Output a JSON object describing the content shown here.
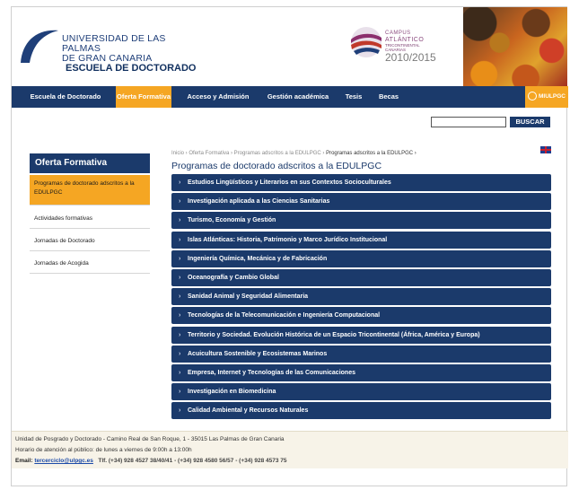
{
  "header": {
    "university_line1": "UNIVERSIDAD DE LAS PALMAS",
    "university_line2": "DE GRAN CANARIA",
    "school": "ESCUELA DE DOCTORADO",
    "campus_line1": "CAMPUS",
    "campus_line2": "ATLÁNTICO",
    "campus_line3": "TRICONTINENTAL",
    "campus_line4": "CANARIAS",
    "campus_year": "2010/2015"
  },
  "nav": {
    "items": [
      {
        "label": "Escuela de Doctorado"
      },
      {
        "label": "Oferta Formativa"
      },
      {
        "label": "Acceso y Admisión"
      },
      {
        "label": "Gestión académica"
      },
      {
        "label": "Tesis"
      },
      {
        "label": "Becas"
      }
    ],
    "mi_ulpgc": "MIULPGC"
  },
  "search": {
    "placeholder": "",
    "button_label": "BUSCAR"
  },
  "sidebar": {
    "title": "Oferta Formativa",
    "items": [
      {
        "label": "Programas de doctorado adscritos a la EDULPGC"
      },
      {
        "label": "Actividades formativas"
      },
      {
        "label": "Jornadas de Doctorado"
      },
      {
        "label": "Jornadas de Acogida"
      }
    ]
  },
  "breadcrumb": {
    "path": "Inicio › Oferta Formativa › Programas adscritos a la EDULPGC ›",
    "current": "Programas adscritos a la EDULPGC ›"
  },
  "main": {
    "title": "Programas de doctorado adscritos a la EDULPGC",
    "programs": [
      {
        "label": "Estudios Lingüísticos y Literarios en sus Contextos Socioculturales"
      },
      {
        "label": "Investigación aplicada a las Ciencias Sanitarias"
      },
      {
        "label": "Turismo, Economía y Gestión"
      },
      {
        "label": "Islas Atlánticas: Historia, Patrimonio y Marco Jurídico Institucional"
      },
      {
        "label": "Ingeniería Química, Mecánica y de Fabricación"
      },
      {
        "label": "Oceanografía y Cambio Global"
      },
      {
        "label": "Sanidad Animal y Seguridad Alimentaria"
      },
      {
        "label": "Tecnologías de la Telecomunicación e Ingeniería Computacional"
      },
      {
        "label": "Territorio y Sociedad. Evolución Histórica de un Espacio Tricontinental (África, América y Europa)"
      },
      {
        "label": "Acuicultura Sostenible y Ecosistemas Marinos"
      },
      {
        "label": "Empresa, Internet y Tecnologías de las Comunicaciones"
      },
      {
        "label": "Investigación en Biomedicina"
      },
      {
        "label": "Calidad Ambiental y Recursos Naturales"
      }
    ]
  },
  "footer": {
    "address": "Unidad de Posgrado y Doctorado - Camino Real de San Roque, 1 - 35015 Las Palmas de Gran Canaria",
    "hours": "Horario de atención al público: de lunes a viernes de 9:00h a 13:00h",
    "email_label": "Email:",
    "email": "tercerciclo@ulpgc.es",
    "phones": "Tlf. (+34) 928 4527 38/40/41 - (+34) 928 4580 56/57 - (+34) 928 4573 75"
  },
  "colors": {
    "navy": "#1b3a6b",
    "orange": "#f5a623",
    "footer_bg": "#f7f3e8"
  }
}
